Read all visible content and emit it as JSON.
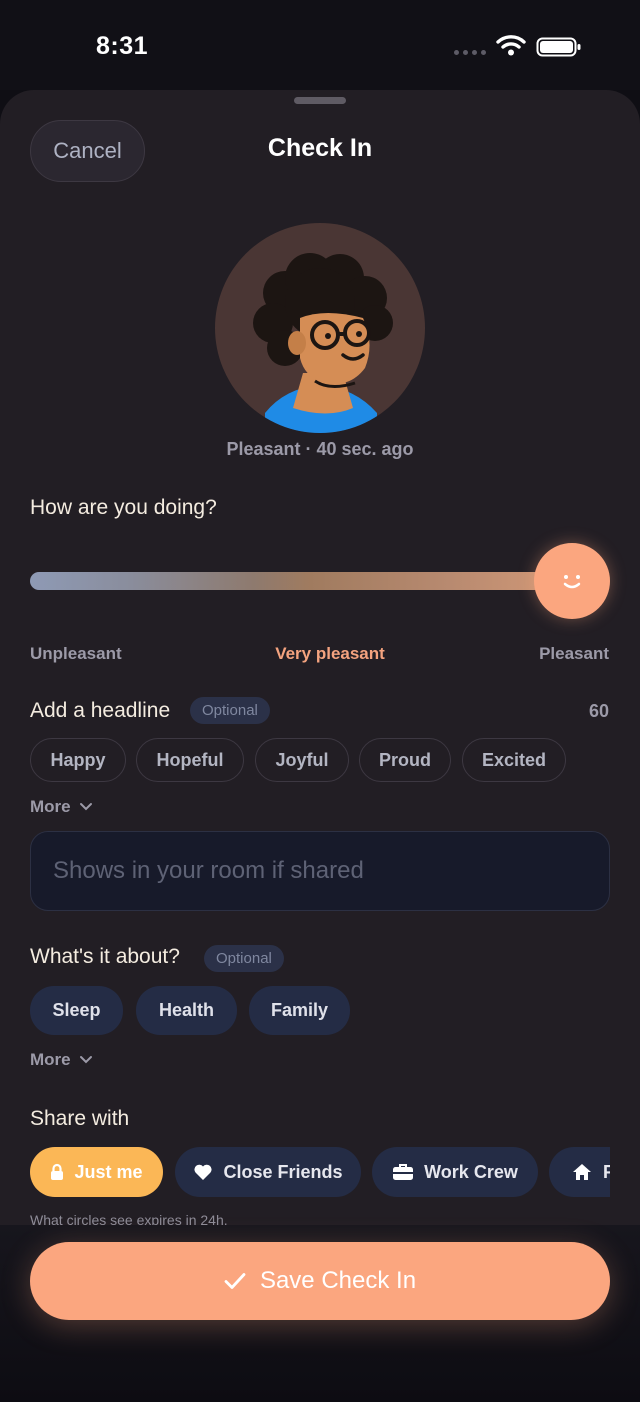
{
  "status": {
    "time": "8:31"
  },
  "header": {
    "cancel_label": "Cancel",
    "title": "Check In"
  },
  "mood": {
    "status_text": "Pleasant · 40 sec. ago"
  },
  "question": "How are you doing?",
  "slider": {
    "value": 0.97,
    "left_label": "Unpleasant",
    "center_label": "Very pleasant",
    "right_label": "Pleasant"
  },
  "headline": {
    "label": "Add a headline",
    "badge": "Optional",
    "char_count": "60",
    "suggestions": [
      "Happy",
      "Hopeful",
      "Joyful",
      "Proud",
      "Excited"
    ],
    "more_label": "More",
    "input_placeholder": "Shows in your room if shared",
    "input_value": ""
  },
  "about": {
    "label": "What's it about?",
    "badge": "Optional",
    "topics": [
      "Sleep",
      "Health",
      "Family"
    ],
    "more_label": "More"
  },
  "share": {
    "label": "Share with",
    "options": [
      "Just me",
      "Close Friends",
      "Work Crew",
      "F"
    ],
    "selected": "Just me",
    "note": "What circles see expires in 24h."
  },
  "footer": {
    "save_label": "Save Check In"
  },
  "colors": {
    "accent": "#fba67f",
    "selected_share": "#fbb756",
    "background": "#221e24"
  }
}
